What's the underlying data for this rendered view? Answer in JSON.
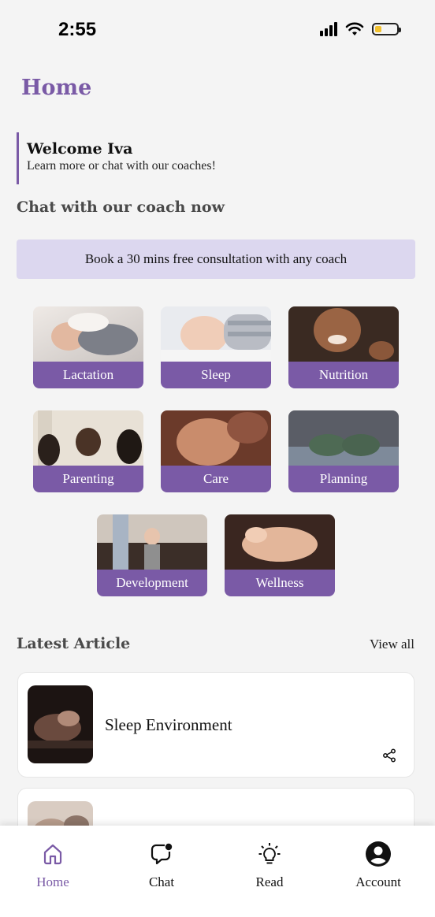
{
  "status": {
    "time": "2:55",
    "battery_level": 0.3
  },
  "header": {
    "title": "Home"
  },
  "welcome": {
    "title": "Welcome Iva",
    "subtitle": "Learn more or chat with our coaches!"
  },
  "coach_section": {
    "title": "Chat with our coach now"
  },
  "booking": {
    "label": "Book a 30 mins free consultation with any coach"
  },
  "categories": [
    {
      "label": "Lactation"
    },
    {
      "label": "Sleep"
    },
    {
      "label": "Nutrition"
    },
    {
      "label": "Parenting"
    },
    {
      "label": "Care"
    },
    {
      "label": "Planning"
    },
    {
      "label": "Development"
    },
    {
      "label": "Wellness"
    }
  ],
  "articles_section": {
    "title": "Latest Article",
    "view_all": "View all"
  },
  "articles": [
    {
      "title": "Sleep Environment"
    },
    {
      "title": ""
    }
  ],
  "nav": {
    "items": [
      {
        "label": "Home",
        "icon": "home-icon",
        "active": true
      },
      {
        "label": "Chat",
        "icon": "chat-icon",
        "active": false
      },
      {
        "label": "Read",
        "icon": "lightbulb-icon",
        "active": false
      },
      {
        "label": "Account",
        "icon": "account-icon",
        "active": false
      }
    ]
  },
  "colors": {
    "accent": "#7a5aa6",
    "banner": "#dcd7ef",
    "background": "#f4f4f4"
  }
}
